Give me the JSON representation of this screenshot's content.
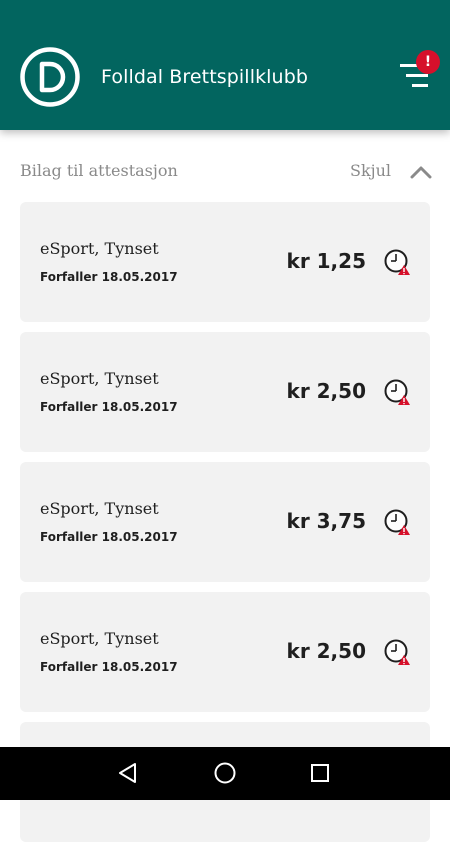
{
  "header": {
    "title": "Folldal Brettspillklubb",
    "logo": "club-logo-icon",
    "menu_icon": "menu-icon",
    "notification_badge": "!",
    "color": "#02655f",
    "badge_color": "#d6102b"
  },
  "section": {
    "title": "Bilag til attestasjon",
    "toggle_label": "Skjul",
    "toggle_icon": "chevron-up-icon"
  },
  "items": [
    {
      "name": "eSport, Tynset",
      "due": "Forfaller 18.05.2017",
      "amount": "kr 1,25",
      "status_icon": "overdue-clock-icon"
    },
    {
      "name": "eSport, Tynset",
      "due": "Forfaller 18.05.2017",
      "amount": "kr 2,50",
      "status_icon": "overdue-clock-icon"
    },
    {
      "name": "eSport, Tynset",
      "due": "Forfaller 18.05.2017",
      "amount": "kr 3,75",
      "status_icon": "overdue-clock-icon"
    },
    {
      "name": "eSport, Tynset",
      "due": "Forfaller 18.05.2017",
      "amount": "kr 2,50",
      "status_icon": "overdue-clock-icon"
    },
    {
      "name": "",
      "due": "",
      "amount": "",
      "status_icon": ""
    }
  ],
  "navbar": {
    "back_icon": "back-icon",
    "home_icon": "home-icon",
    "recents_icon": "recents-icon"
  }
}
